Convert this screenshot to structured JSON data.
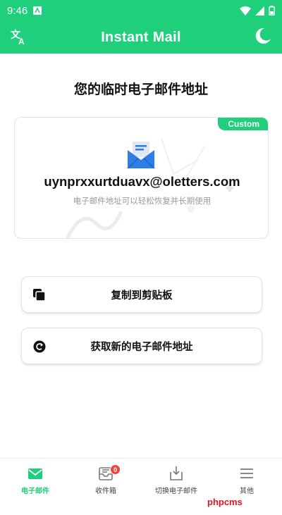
{
  "status_bar": {
    "time": "9:46"
  },
  "app_bar": {
    "title": "Instant Mail"
  },
  "main": {
    "heading": "您的临时电子邮件地址",
    "card": {
      "badge": "Custom",
      "email": "uynprxxurtduavx@oletters.com",
      "hint": "电子邮件地址可以轻松恢复并长期使用"
    },
    "buttons": {
      "copy": "复制到剪贴板",
      "new_address": "获取新的电子邮件地址"
    }
  },
  "bottom_nav": {
    "items": [
      {
        "label": "电子邮件",
        "active": true
      },
      {
        "label": "收件箱",
        "badge": "0"
      },
      {
        "label": "切换电子邮件"
      },
      {
        "label": "其他"
      }
    ]
  },
  "watermark": "phpcms",
  "colors": {
    "accent": "#1fcf7c",
    "badge_red": "#f0443c",
    "watermark_red": "#e0151e"
  }
}
